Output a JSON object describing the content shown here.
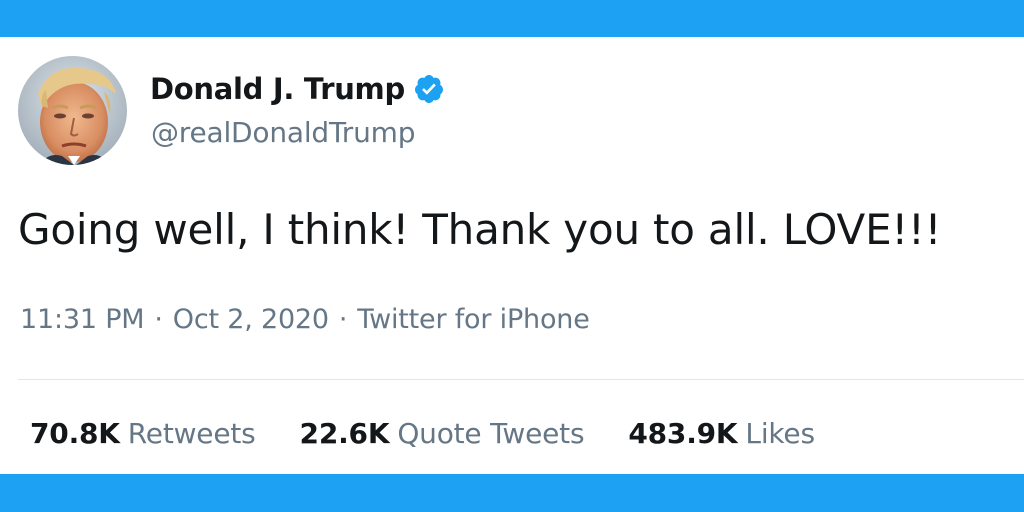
{
  "colors": {
    "brand_blue": "#1da1f2",
    "text_primary": "#14171a",
    "text_secondary": "#657786",
    "divider": "#e1e8ed",
    "verified_badge": "#1da1f2"
  },
  "user": {
    "display_name": "Donald J. Trump",
    "handle": "@realDonaldTrump",
    "verified": true,
    "avatar_icon": "profile-photo",
    "verified_icon": "verified-badge-icon"
  },
  "tweet": {
    "text": "Going well, I think! Thank you to all. LOVE!!!",
    "time": "11:31 PM",
    "date": "Oct 2, 2020",
    "source": "Twitter for iPhone",
    "separator": "·"
  },
  "stats": {
    "retweets": {
      "count": "70.8K",
      "label": "Retweets"
    },
    "quote_tweets": {
      "count": "22.6K",
      "label": "Quote Tweets"
    },
    "likes": {
      "count": "483.9K",
      "label": "Likes"
    }
  }
}
